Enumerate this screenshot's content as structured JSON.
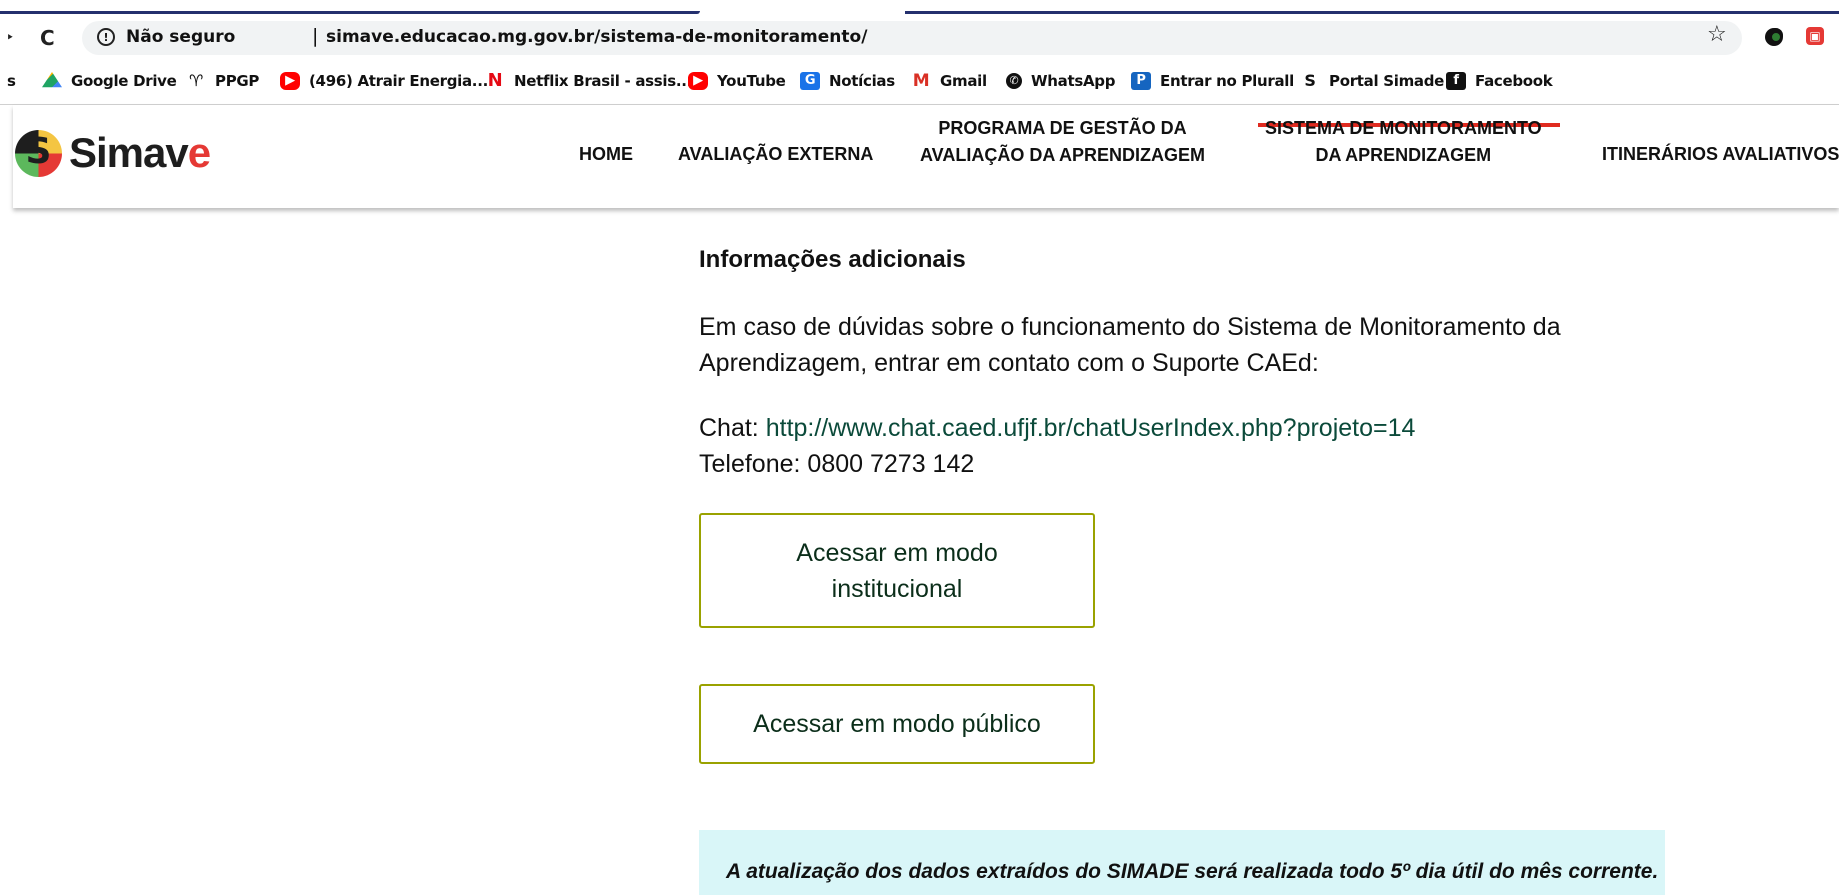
{
  "browser": {
    "back_glyph": "‣",
    "reload_glyph": "C",
    "security_label": "Não seguro",
    "address_separator": "|",
    "url": "simave.educacao.mg.gov.br/sistema-de-monitoramento/",
    "star_glyph": "☆",
    "ext2_glyph": "▣"
  },
  "bookmarks": [
    {
      "label": "s",
      "icon": "cut-bookmark"
    },
    {
      "label": "Google Drive",
      "icon": "google-drive-icon"
    },
    {
      "label": "PPGP",
      "icon": "ppgp-icon",
      "glyph": "♈"
    },
    {
      "label": "(496) Atrair Energia...",
      "icon": "youtube-icon",
      "glyph": "▶"
    },
    {
      "label": "Netflix Brasil - assis...",
      "icon": "netflix-icon",
      "glyph": "N"
    },
    {
      "label": "YouTube",
      "icon": "youtube-icon",
      "glyph": "▶"
    },
    {
      "label": "Notícias",
      "icon": "google-news-icon",
      "glyph": "G"
    },
    {
      "label": "Gmail",
      "icon": "gmail-icon",
      "glyph": "M"
    },
    {
      "label": "WhatsApp",
      "icon": "whatsapp-icon",
      "glyph": "✆"
    },
    {
      "label": "Entrar no Plurall",
      "icon": "plurall-icon",
      "glyph": "P"
    },
    {
      "label": "Portal Simade",
      "icon": "simade-icon",
      "glyph": "S"
    },
    {
      "label": "Facebook",
      "icon": "facebook-icon",
      "glyph": "f"
    }
  ],
  "site": {
    "logo_text_main": "Simav",
    "logo_text_accent": "e",
    "nav": [
      {
        "label": "HOME"
      },
      {
        "label": "AVALIAÇÃO EXTERNA"
      },
      {
        "line1": "PROGRAMA DE GESTÃO DA",
        "line2": "AVALIAÇÃO DA APRENDIZAGEM"
      },
      {
        "line1": "SISTEMA DE MONITORAMENTO",
        "line2": "DA APRENDIZAGEM",
        "active": true
      },
      {
        "label": "ITINERÁRIOS AVALIATIVOS"
      }
    ],
    "accent_color": "#e02b20"
  },
  "content": {
    "heading": "Informações adicionais",
    "paragraph": "Em caso de dúvidas sobre o funcionamento do Sistema de Monitoramento da Aprendizagem, entrar em contato com o Suporte CAEd:",
    "chat_label": "Chat:",
    "chat_url": "http://www.chat.caed.ufjf.br/chatUserIndex.php?projeto=14",
    "phone_label": "Telefone:",
    "phone_number": "0800 7273 142",
    "btn_institucional": "Acessar em modo institucional",
    "btn_publico": "Acessar em modo público",
    "notice": "A atualização dos dados extraídos do SIMADE será realizada todo 5º dia útil do mês corrente.",
    "button_border_color": "#9aa200",
    "notice_bg_color": "#d9f6f8"
  }
}
